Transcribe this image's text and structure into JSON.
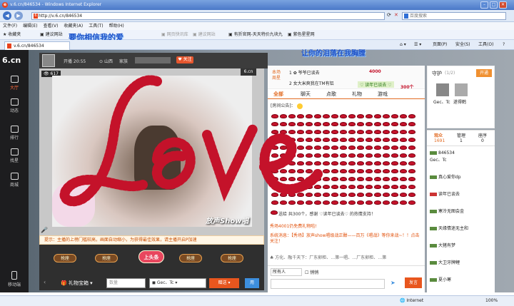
{
  "window": {
    "title": "v.6.cn/846534 - Windows Internet Explorer"
  },
  "address": {
    "url": "http://v.6.cn/846534",
    "search_placeholder": "百度搜索"
  },
  "menu": [
    "文件(F)",
    "编辑(E)",
    "查看(V)",
    "收藏夹(A)",
    "工具(T)",
    "帮助(H)"
  ],
  "favbar": {
    "favorites": "收藏夹",
    "items": [
      "建议网站",
      "网页快讯库",
      "建议网站",
      "有折官网-天天特价九块九",
      "紫色星星网"
    ],
    "overlay_text": "要你相信我的爱"
  },
  "tab": {
    "label": "v.6.cn/846534"
  },
  "toolbar": {
    "page": "页面(P)",
    "safety": "安全(S)",
    "tools": "工具(O)"
  },
  "overlay_text2": "让你的泪落在我胸膛",
  "leftnav": {
    "logo": "6.cn",
    "items": [
      "大厅",
      "动态",
      "排行",
      "找星",
      "商城"
    ],
    "mobile": "移动端"
  },
  "room": {
    "time": "开播 20:55",
    "location": "山西",
    "family": "家族",
    "follow": "关注",
    "viewers": "617",
    "brand": "6.cn",
    "watermark": "放声Show唱"
  },
  "notice": "提示：主播的上榜门槛较高，画面自动缩小，为获得最佳效果，请主播开启P加速",
  "gifts": {
    "grab": [
      "抢座",
      "抢座",
      "抢座",
      "抢座",
      "抢座"
    ],
    "top": "上头条",
    "giftbox": "礼物宝箱",
    "qty_placeholder": "数量",
    "recipient": "Gec、Tc",
    "send": "赠送",
    "use": "用"
  },
  "ranking": {
    "week_label": "本场",
    "week_label2": "周星",
    "entries": [
      "1 ✿ 爷爷已谈去",
      "2 女大米爽我在TM有铝"
    ],
    "value1": "4000",
    "value2": "300个",
    "sender": "♡ 读年已谈去 ♡"
  },
  "chat": {
    "tabs": [
      "全部",
      "聊天",
      "点歌",
      "礼物",
      "游戏"
    ],
    "announcement": "[房间公告]：",
    "gift_line": "送给 共300个，感谢 ♡读年已谈去♡ 的热情支持！",
    "msg1": "秀场4001仍免费礼物啦!",
    "msg2": "系统消息：【秀场】放声show唱级战正酣——百万《唱战》等你来战~！！点击关注！",
    "msg3": "♣ 方化、融千天下：厂东卵柜、…第一唱、…厂东卵柜、…第",
    "target": "所有人",
    "whisper": "悄悄",
    "send": "发言"
  },
  "guard": {
    "title": "守护",
    "count": "(1/2)",
    "open": "开通",
    "members": [
      "Gec、Tc",
      "遂得鹤"
    ]
  },
  "audience": {
    "tabs": [
      "观众",
      "管理",
      "座序"
    ],
    "count": "1691",
    "admin_count": "1",
    "seat_count": "0",
    "list": [
      "846534",
      "Gec、Tc",
      "真心爱你dp",
      "读年已谈去",
      "♡读年已谈去",
      "寒泠无图会金",
      "天缘情迷无主和",
      "大猪有梦",
      "大卫牙牌鲤",
      "夏小寒"
    ]
  },
  "statusbar": {
    "zone": "Internet",
    "zoom": "100%"
  }
}
